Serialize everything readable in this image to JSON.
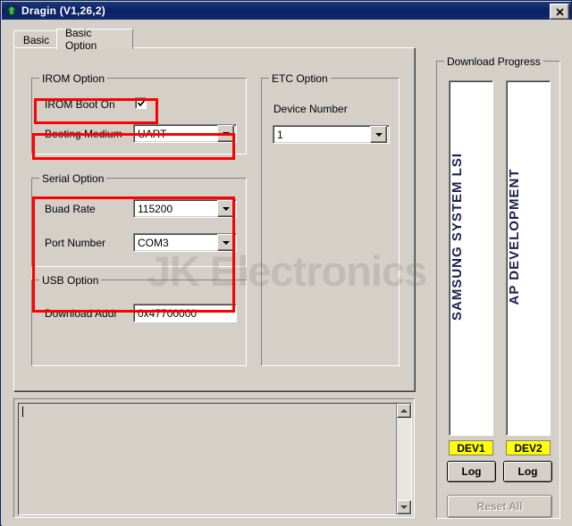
{
  "window": {
    "title": "Dragin (V1,26,2)",
    "icon": "green-arrow-icon",
    "close_label": "✕"
  },
  "tabs": [
    {
      "label": "Basic",
      "active": false
    },
    {
      "label": "Basic Option",
      "active": true
    }
  ],
  "irom_option": {
    "title": "IROM Option",
    "boot_on_label": "IROM Boot On",
    "boot_on_checked": true,
    "booting_medium_label": "Booting Medium",
    "booting_medium_value": "UART"
  },
  "serial_option": {
    "title": "Serial Option",
    "baud_rate_label": "Buad Rate",
    "baud_rate_value": "115200",
    "port_number_label": "Port Number",
    "port_number_value": "COM3"
  },
  "usb_option": {
    "title": "USB Option",
    "download_addr_label": "Download Addr",
    "download_addr_value": "0x47700000"
  },
  "etc_option": {
    "title": "ETC Option",
    "device_number_label": "Device Number",
    "device_number_value": "1"
  },
  "download_progress": {
    "title": "Download Progress",
    "bars": [
      {
        "text": "SAMSUNG SYSTEM LSI",
        "device_label": "DEV1",
        "log_label": "Log",
        "percent": 0
      },
      {
        "text": "AP DEVELOPMENT",
        "device_label": "DEV2",
        "log_label": "Log",
        "percent": 0
      }
    ],
    "reset_all_label": "Reset All",
    "reset_all_enabled": false
  },
  "log_area": {
    "value": "",
    "scroll_up_icon": "triangle-up-icon",
    "scroll_down_icon": "triangle-down-icon"
  },
  "watermark": "JK Electronics",
  "colors": {
    "window_face": "#d4d0c8",
    "titlebar": "#0a2062",
    "annotation": "#ff0000",
    "device_label_bg": "#ffff00",
    "progress_text": "#1a1f4e"
  }
}
